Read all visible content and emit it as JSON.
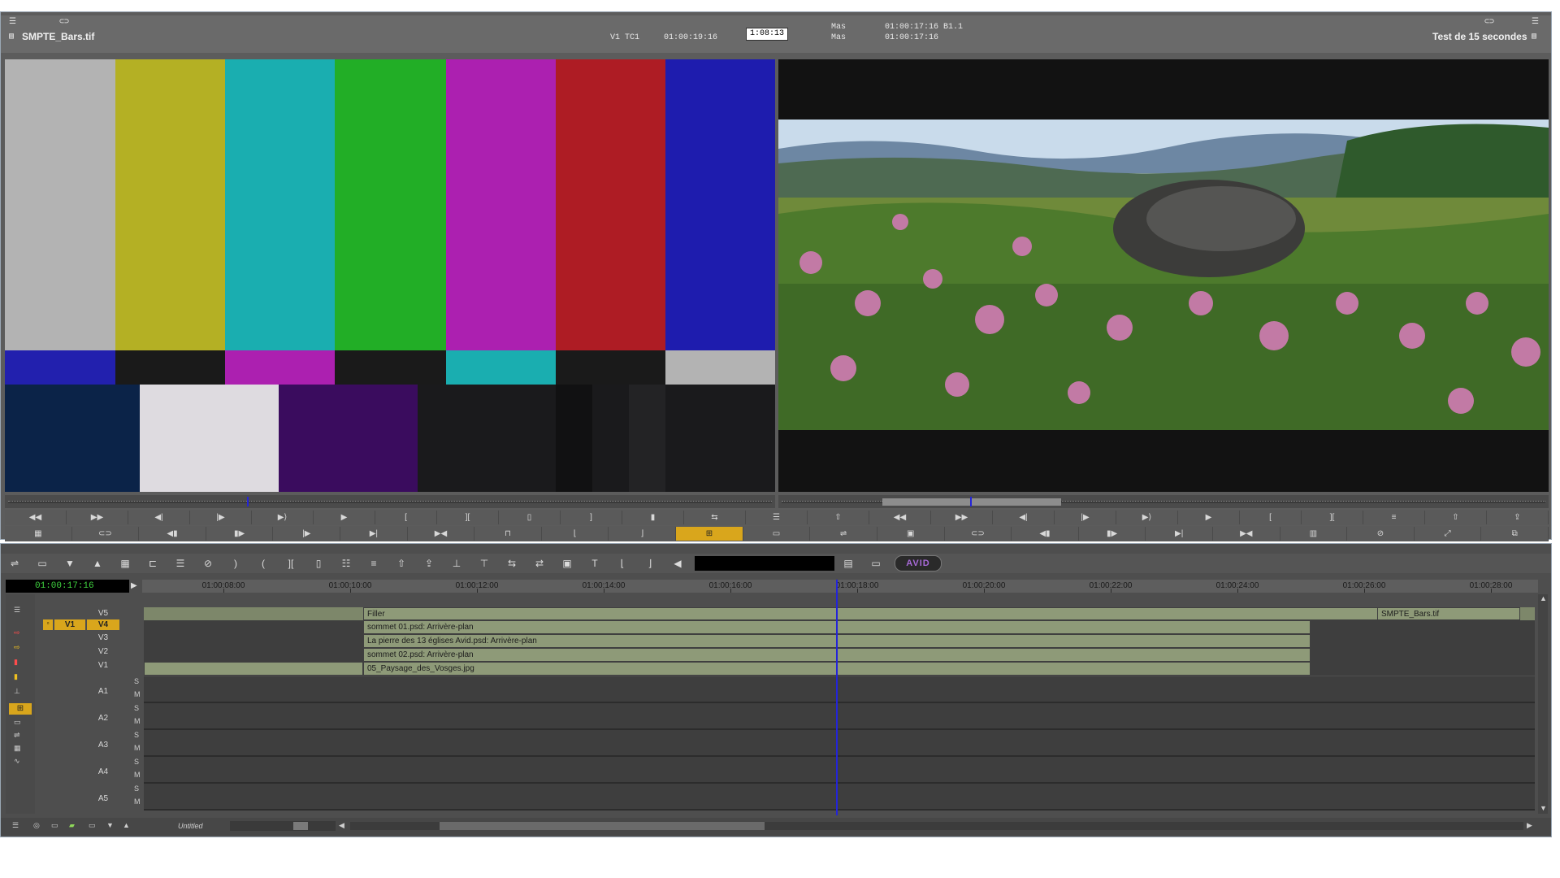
{
  "source": {
    "clip_name": "SMPTE_Bars.tif",
    "track_label": "V1 TC1",
    "timecode": "01:00:19:16",
    "duration": "1:08:13"
  },
  "record": {
    "mas_label_1": "Mas",
    "mas_label_2": "Mas",
    "tc_1": "01:00:17:16 B1.1",
    "tc_2": "01:00:17:16",
    "sequence_name": "Test de 15 secondes"
  },
  "colors": {
    "accent_yellow": "#d9a61c",
    "playhead_blue": "#2424d8",
    "clip_green": "#8e9a78",
    "timecode_green": "#3fd13f"
  },
  "timeline": {
    "timecode": "01:00:17:16",
    "logo": "AVID",
    "ruler": [
      "01:00:08:00",
      "01:00:10:00",
      "01:00:12:00",
      "01:00:14:00",
      "01:00:16:00",
      "01:00:18:00",
      "01:00:20:00",
      "01:00:22:00",
      "01:00:24:00",
      "01:00:26:00",
      "01:00:28:00"
    ],
    "record_track": "V1",
    "tracks": {
      "v5": {
        "label": "V5",
        "clip": "Filler",
        "end_clip": "SMPTE_Bars.tif"
      },
      "v4": {
        "label": "V4",
        "clip": "sommet 01.psd: Arrivère-plan"
      },
      "v3": {
        "label": "V3",
        "clip": "La pierre des 13 églises Avid.psd: Arrivère-plan"
      },
      "v2": {
        "label": "V2",
        "clip": "sommet 02.psd: Arrivère-plan"
      },
      "v1": {
        "label": "V1",
        "clip": "05_Paysage_des_Vosges.jpg"
      },
      "a1": {
        "label": "A1"
      },
      "a2": {
        "label": "A2"
      },
      "a3": {
        "label": "A3"
      },
      "a4": {
        "label": "A4"
      },
      "a5": {
        "label": "A5"
      }
    },
    "bottom_label": "Untitled",
    "s_label": "S",
    "m_label": "M"
  }
}
